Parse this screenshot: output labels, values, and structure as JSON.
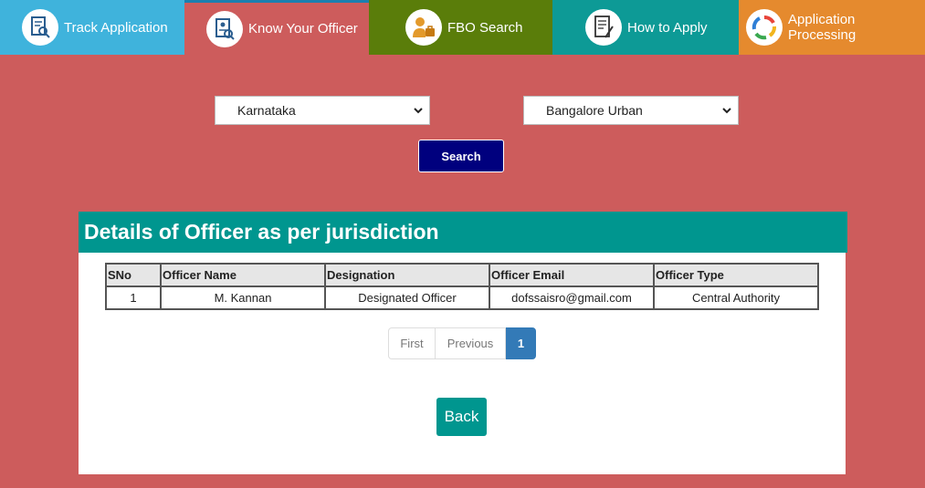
{
  "tabs": [
    {
      "label": "Track Application",
      "icon": "document-search-icon"
    },
    {
      "label": "Know Your Officer",
      "icon": "officer-document-icon"
    },
    {
      "label": "FBO Search",
      "icon": "business-person-icon"
    },
    {
      "label": "How to Apply",
      "icon": "form-pen-icon"
    },
    {
      "label": "Application Processing",
      "icon": "cycle-icon"
    }
  ],
  "filters": {
    "state": "Karnataka",
    "district": "Bangalore Urban",
    "search_label": "Search"
  },
  "panel": {
    "title": "Details of Officer as per jurisdiction",
    "columns": [
      "SNo",
      "Officer Name",
      "Designation",
      "Officer Email",
      "Officer Type"
    ],
    "rows": [
      [
        "1",
        "M. Kannan",
        "Designated Officer",
        "dofssaisro@gmail.com",
        "Central Authority"
      ]
    ]
  },
  "pagination": {
    "first": "First",
    "previous": "Previous",
    "current": "1"
  },
  "back_label": "Back"
}
